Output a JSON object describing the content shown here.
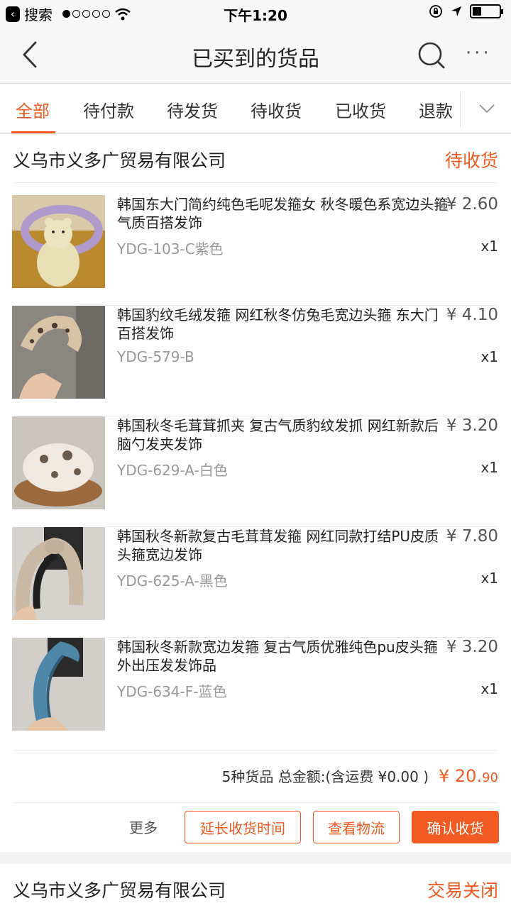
{
  "status_bar": {
    "back_label": "搜索",
    "time": "下午1:20",
    "signal_dots": "●○○○○"
  },
  "nav": {
    "title": "已买到的货品",
    "more": "···"
  },
  "tabs": [
    {
      "label": "全部"
    },
    {
      "label": "待付款"
    },
    {
      "label": "待发货"
    },
    {
      "label": "待收货"
    },
    {
      "label": "已收货"
    },
    {
      "label": "退款"
    }
  ],
  "colors": {
    "accent": "#f15a22",
    "muted": "#999999"
  },
  "orders": [
    {
      "shop": "义乌市义多广贸易有限公司",
      "status": "待收货",
      "items": [
        {
          "title": "韩国东大门简约纯色毛呢发箍女 秋冬暖色系宽边头箍气质百搭发饰",
          "sku": "YDG-103-C紫色",
          "price": "¥ 2.60",
          "qty": "x1"
        },
        {
          "title": "韩国豹纹毛绒发箍 网红秋冬仿兔毛宽边头箍 东大门百搭发饰",
          "sku": "YDG-579-B",
          "price": "¥ 4.10",
          "qty": "x1"
        },
        {
          "title": "韩国秋冬毛茸茸抓夹 复古气质豹纹发抓 网红新款后脑勺发夹发饰",
          "sku": "YDG-629-A-白色",
          "price": "¥ 3.20",
          "qty": "x1"
        },
        {
          "title": "韩国秋冬新款复古毛茸茸发箍 网红同款打结PU皮质头箍宽边发饰",
          "sku": "YDG-625-A-黑色",
          "price": "¥ 7.80",
          "qty": "x1"
        },
        {
          "title": "韩国秋冬新款宽边发箍 复古气质优雅纯色pu皮头箍外出压发发饰品",
          "sku": "YDG-634-F-蓝色",
          "price": "¥ 3.20",
          "qty": "x1"
        }
      ],
      "summary": "5种货品 总金额:(含运费 ¥0.00 )",
      "total_main": "¥ 20.",
      "total_cents": "90",
      "actions": {
        "more": "更多",
        "extend": "延长收货时间",
        "logistics": "查看物流",
        "confirm": "确认收货"
      }
    },
    {
      "shop": "义乌市义多广贸易有限公司",
      "status": "交易关闭"
    }
  ]
}
